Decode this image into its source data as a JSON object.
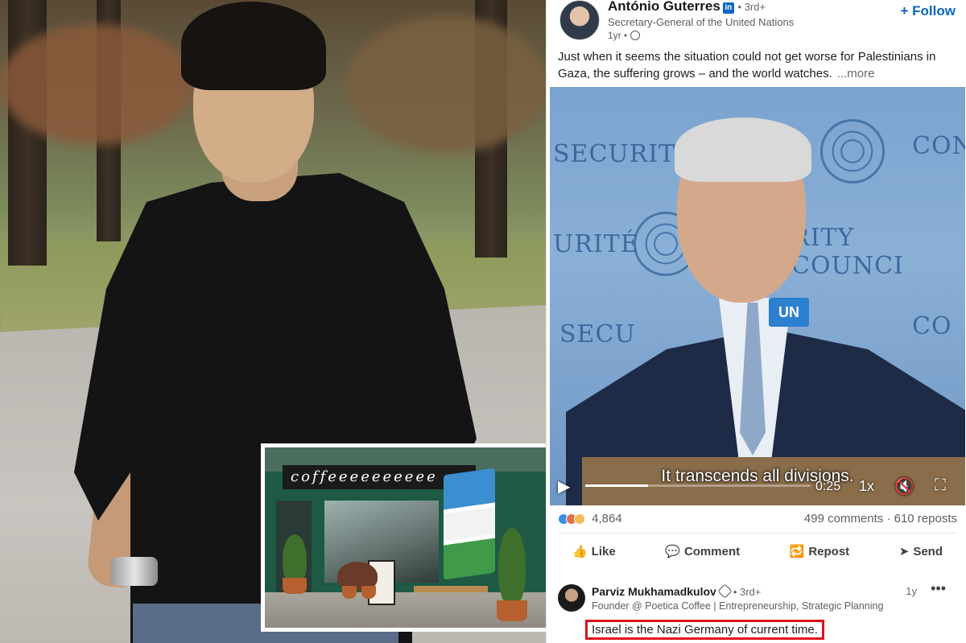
{
  "post": {
    "author": "António Guterres",
    "degree": "• 3rd+",
    "subtitle": "Secretary-General of the United Nations",
    "time": "1yr •",
    "follow_label": "+ Follow",
    "text": "Just when it seems the situation could not get worse for Palestinians in Gaza, the suffering grows – and the world watches.",
    "more_label": "...more"
  },
  "video": {
    "wall_text_1": "SECURITY",
    "wall_text_2": "CO",
    "wall_text_3": "URITÉ",
    "wall_text_4": "RITY COUNCI",
    "wall_text_5": "SECU",
    "wall_text_6": "CON",
    "mic_label": "UN",
    "caption": "It transcends all divisions.",
    "elapsed": "0:25",
    "speed": "1x",
    "progress": 0.28
  },
  "stats": {
    "reaction_count": "4,864",
    "comments_reposts": "499 comments · 610 reposts"
  },
  "actions": [
    {
      "label": "Like",
      "icon": "thumbs-up-icon",
      "glyph": "👍"
    },
    {
      "label": "Comment",
      "icon": "comment-icon",
      "glyph": "💬"
    },
    {
      "label": "Repost",
      "icon": "repost-icon",
      "glyph": "🔁"
    },
    {
      "label": "Send",
      "icon": "send-icon",
      "glyph": "➤"
    }
  ],
  "comment": {
    "name": "Parviz Mukhamadkulov",
    "degree": "• 3rd+",
    "subtitle": "Founder @ Poetica Coffee | Entrepreneurship, Strategic Planning",
    "time": "1y",
    "menu": "•••",
    "text": "Israel is the Nazi Germany of current time."
  },
  "inset": {
    "awning_text": "coffeeeeeeeeee"
  },
  "colors": {
    "linkedin_blue": "#0a66c2",
    "highlight_red": "#e0111b"
  }
}
